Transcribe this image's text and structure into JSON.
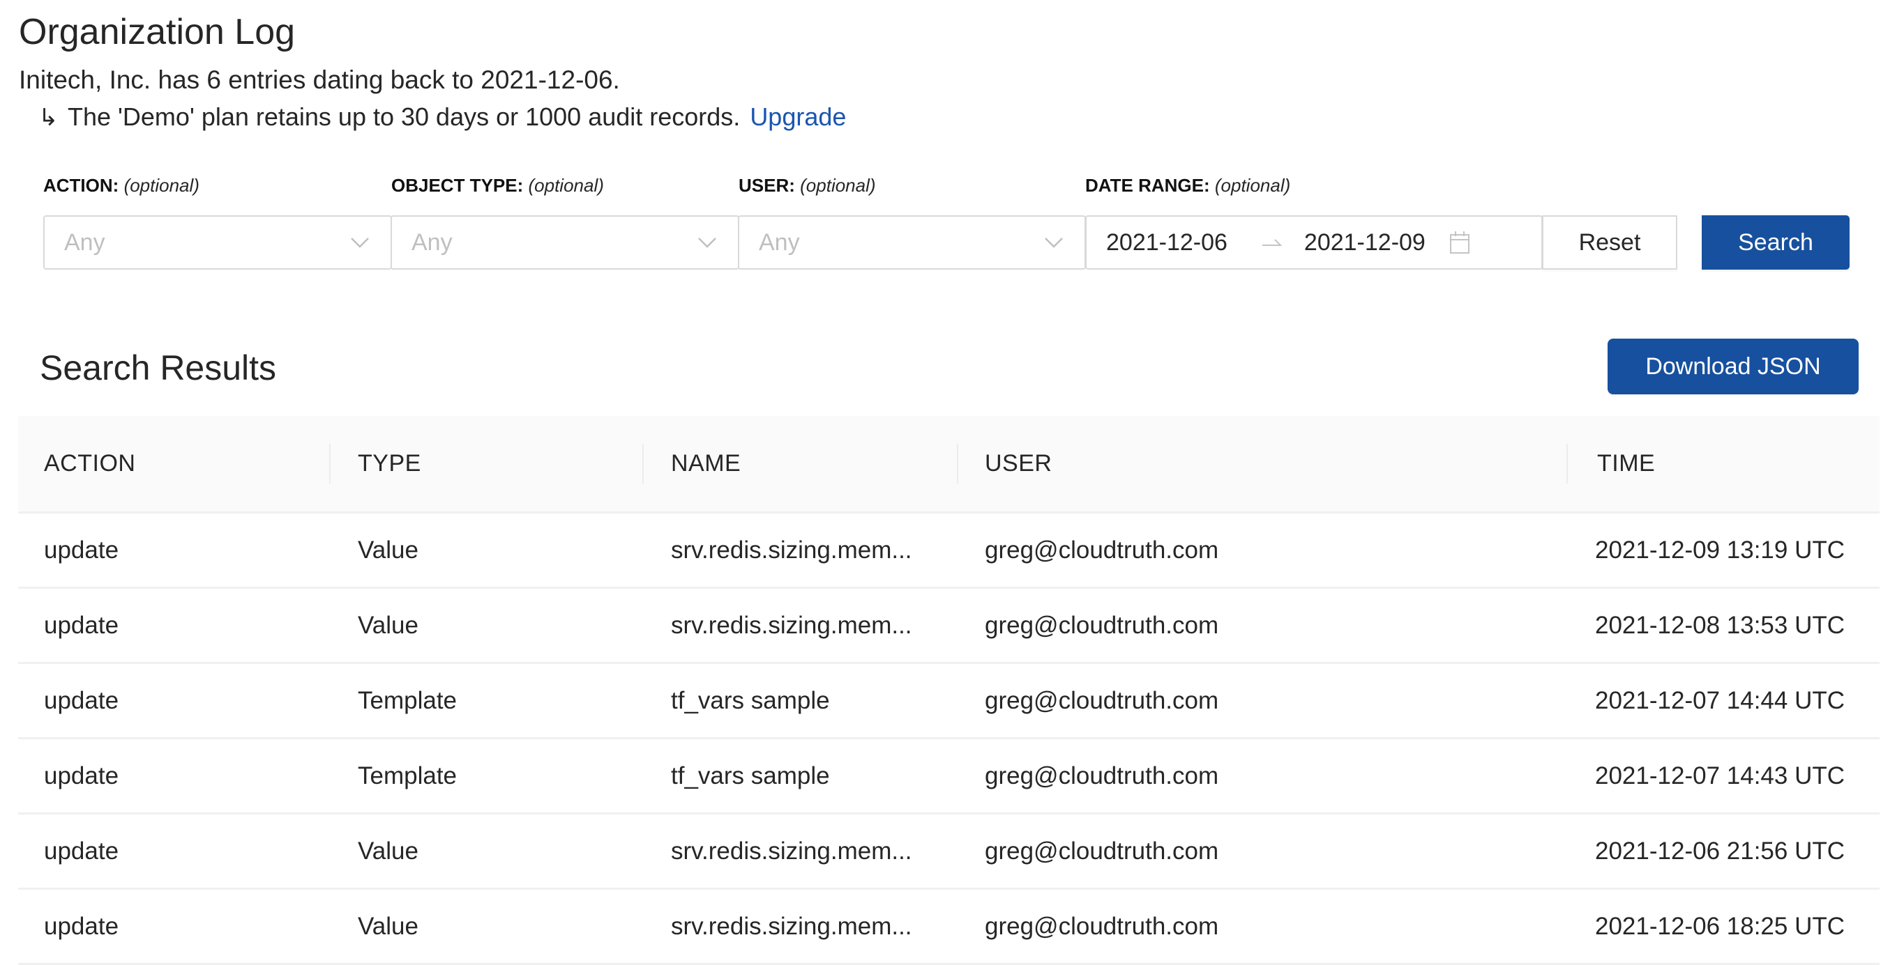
{
  "header": {
    "title": "Organization Log",
    "summary": "Initech, Inc. has 6 entries dating back to 2021-12-06.",
    "retention_icon": "return-arrow-icon",
    "retention_text": "The 'Demo' plan retains up to 30 days or 1000 audit records.",
    "upgrade_link": "Upgrade"
  },
  "filters": {
    "action": {
      "label": "ACTION:",
      "hint": "(optional)",
      "placeholder": "Any"
    },
    "object_type": {
      "label": "OBJECT TYPE:",
      "hint": "(optional)",
      "placeholder": "Any"
    },
    "user": {
      "label": "USER:",
      "hint": "(optional)",
      "placeholder": "Any"
    },
    "date_range": {
      "label": "DATE RANGE:",
      "hint": "(optional)",
      "start": "2021-12-06",
      "end": "2021-12-09"
    },
    "reset_label": "Reset",
    "search_label": "Search"
  },
  "results": {
    "title": "Search Results",
    "download_label": "Download JSON",
    "columns": [
      "ACTION",
      "TYPE",
      "NAME",
      "USER",
      "TIME"
    ],
    "rows": [
      {
        "action": "update",
        "type": "Value",
        "name": "srv.redis.sizing.mem...",
        "user": "greg@cloudtruth.com",
        "time": "2021-12-09 13:19 UTC"
      },
      {
        "action": "update",
        "type": "Value",
        "name": "srv.redis.sizing.mem...",
        "user": "greg@cloudtruth.com",
        "time": "2021-12-08 13:53 UTC"
      },
      {
        "action": "update",
        "type": "Template",
        "name": "tf_vars sample",
        "user": "greg@cloudtruth.com",
        "time": "2021-12-07 14:44 UTC"
      },
      {
        "action": "update",
        "type": "Template",
        "name": "tf_vars sample",
        "user": "greg@cloudtruth.com",
        "time": "2021-12-07 14:43 UTC"
      },
      {
        "action": "update",
        "type": "Value",
        "name": "srv.redis.sizing.mem...",
        "user": "greg@cloudtruth.com",
        "time": "2021-12-06 21:56 UTC"
      },
      {
        "action": "update",
        "type": "Value",
        "name": "srv.redis.sizing.mem...",
        "user": "greg@cloudtruth.com",
        "time": "2021-12-06 18:25 UTC"
      }
    ]
  },
  "colors": {
    "primary": "#17509e",
    "link": "#1a55b0",
    "text": "#262626",
    "placeholder": "#bfbfbf",
    "table_header_bg": "#fafafa",
    "border": "#d9d9d9"
  }
}
